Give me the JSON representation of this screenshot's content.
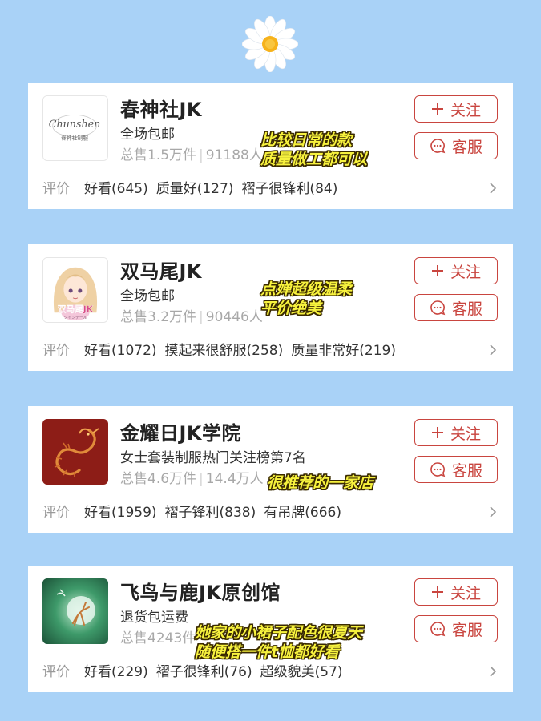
{
  "decoration": {
    "icon": "daisy-icon"
  },
  "shops": [
    {
      "name": "春神社JK",
      "subtitle": "全场包邮",
      "sales": "总售1.5万件",
      "fans": "91188人",
      "logo_text_main": "Chunshen",
      "logo_text_sub": "春神社制服",
      "follow_label": "关注",
      "service_label": "客服",
      "review_label": "评价",
      "tags": [
        "好看(645)",
        "质量好(127)",
        "褶子很锋利(84)"
      ],
      "note": [
        "比较日常的款",
        "质量做工都可以"
      ]
    },
    {
      "name": "双马尾JK",
      "subtitle": "全场包邮",
      "sales": "总售3.2万件",
      "fans": "90446人",
      "logo_text_main": "双马尾JK",
      "logo_text_sub": "ツインテール",
      "follow_label": "关注",
      "service_label": "客服",
      "review_label": "评价",
      "tags": [
        "好看(1072)",
        "摸起来很舒服(258)",
        "质量非常好(219)"
      ],
      "note": [
        "点婵超级温柔",
        "平价绝美"
      ]
    },
    {
      "name": "金耀日JK学院",
      "subtitle": "女士套装制服热门关注榜第7名",
      "sales": "总售4.6万件",
      "fans": "14.4万人",
      "follow_label": "关注",
      "service_label": "客服",
      "review_label": "评价",
      "tags": [
        "好看(1959)",
        "褶子锋利(838)",
        "有吊牌(666)"
      ],
      "note": [
        "很推荐的一家店"
      ]
    },
    {
      "name": "飞鸟与鹿JK原创馆",
      "subtitle": "退货包运费",
      "sales": "总售4243件",
      "fans": "",
      "follow_label": "关注",
      "service_label": "客服",
      "review_label": "评价",
      "tags": [
        "好看(229)",
        "褶子很锋利(76)",
        "超级貌美(57)"
      ],
      "note": [
        "她家的小裙子配色很夏天",
        "随便搭一件t恤都好看"
      ]
    }
  ],
  "colors": {
    "background": "#a9d2f7",
    "accent": "#c9453f",
    "note_fill": "#f7f23e"
  }
}
